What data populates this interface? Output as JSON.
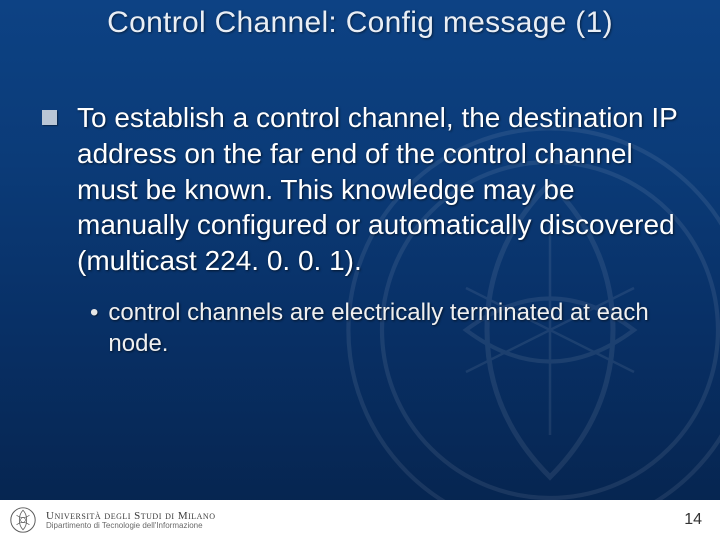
{
  "title": "Control Channel: Config message (1)",
  "bullets": {
    "level1": "To establish a control channel, the destination IP address on the far end of the control channel must be known. This knowledge may be manually configured or automatically discovered (multicast 224. 0. 0. 1).",
    "level2": "control channels are electrically terminated at each node."
  },
  "footer": {
    "university": "Università degli Studi di Milano",
    "department": "Dipartimento di Tecnologie dell'Informazione",
    "page": "14"
  }
}
